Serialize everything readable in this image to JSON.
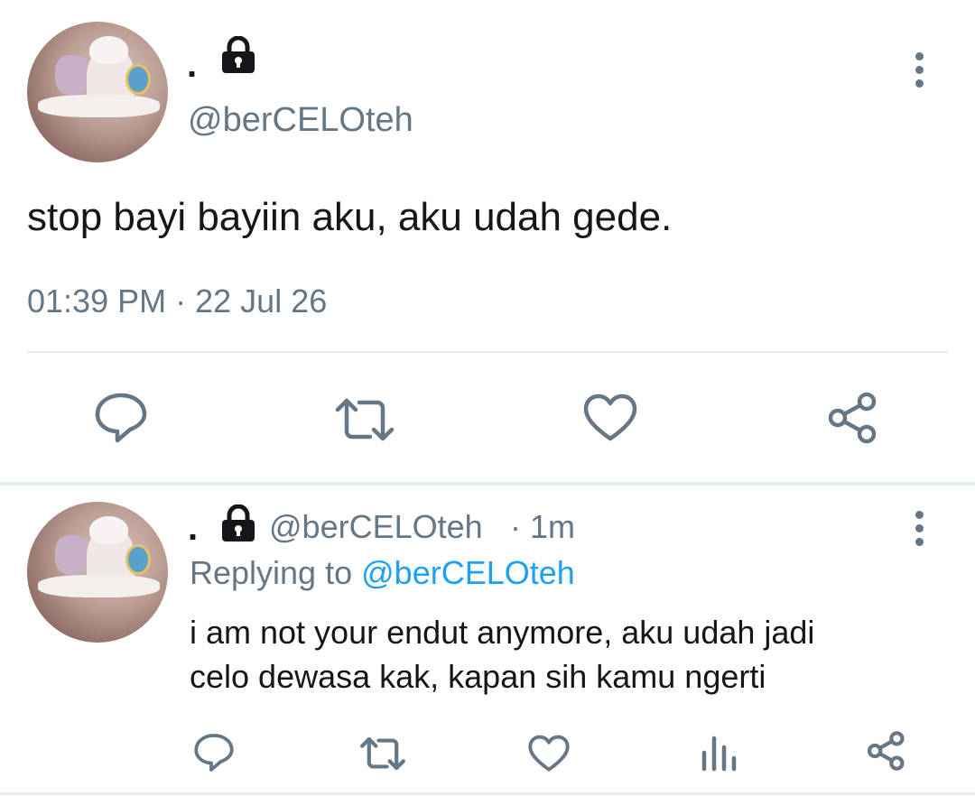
{
  "main_tweet": {
    "display_name": ".",
    "handle": "@berCELOteh",
    "text": "stop bayi bayiin aku, aku udah gede.",
    "time": "01:39 PM",
    "separator": "·",
    "date": "22 Jul 26",
    "icons": {
      "lock": "lock-icon",
      "menu": "more-vertical-icon",
      "reply": "reply-icon",
      "retweet": "retweet-icon",
      "like": "heart-icon",
      "share": "share-icon"
    }
  },
  "reply_tweet": {
    "display_name": ".",
    "handle": "@berCELOteh",
    "time_ago": "· 1m",
    "replying_prefix": "Replying to",
    "replying_handle": "@berCELOteh",
    "text_line1": "i am not your endut anymore, aku udah jadi",
    "text_line2": "celo dewasa kak, kapan sih kamu ngerti",
    "icons": {
      "reply": "reply-icon",
      "retweet": "retweet-icon",
      "like": "heart-icon",
      "stats": "analytics-icon",
      "share": "share-icon"
    }
  },
  "colors": {
    "text": "#14171a",
    "secondary": "#657786",
    "accent": "#1da1f2",
    "divider": "#e6ecf0"
  }
}
